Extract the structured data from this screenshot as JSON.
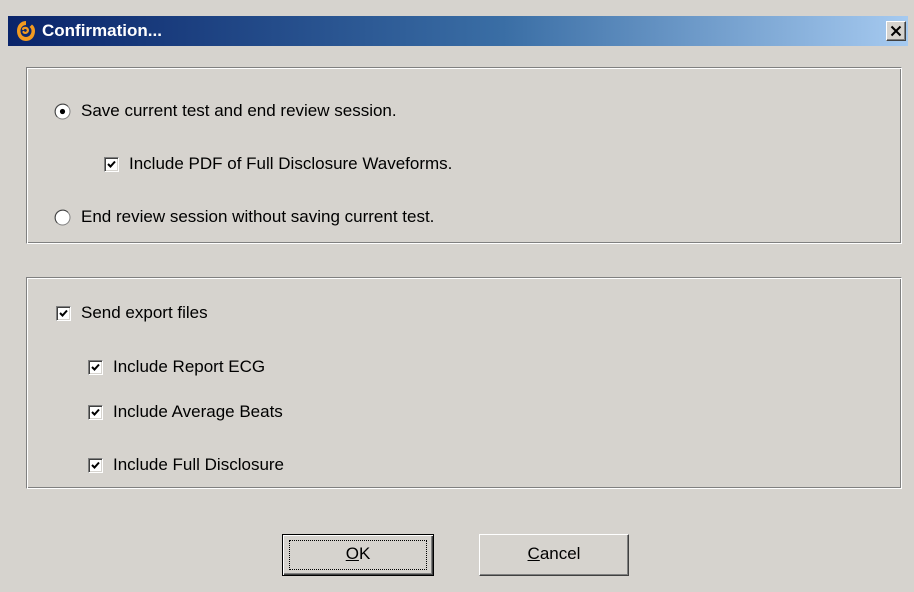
{
  "window": {
    "title": "Confirmation...",
    "icon": "app-logo-icon",
    "close_glyph": "×"
  },
  "session_group": {
    "options": [
      {
        "label": "Save current test and end review session.",
        "selected": true
      },
      {
        "label": "End review session without saving current test.",
        "selected": false
      }
    ],
    "include_pdf": {
      "label": "Include PDF of Full Disclosure Waveforms.",
      "checked": true
    }
  },
  "export_group": {
    "send_export": {
      "label": "Send export files",
      "checked": true
    },
    "items": [
      {
        "label": "Include Report ECG",
        "checked": true
      },
      {
        "label": "Include Average Beats",
        "checked": true
      },
      {
        "label": "Include Full Disclosure",
        "checked": true
      }
    ]
  },
  "buttons": {
    "ok": {
      "mnemonic": "O",
      "rest": "K"
    },
    "cancel": {
      "mnemonic": "C",
      "rest": "ancel"
    }
  },
  "colors": {
    "dialog_bg": "#d6d3ce",
    "title_start": "#0a246a",
    "title_end": "#a6caf0",
    "title_text": "#ffffff"
  }
}
